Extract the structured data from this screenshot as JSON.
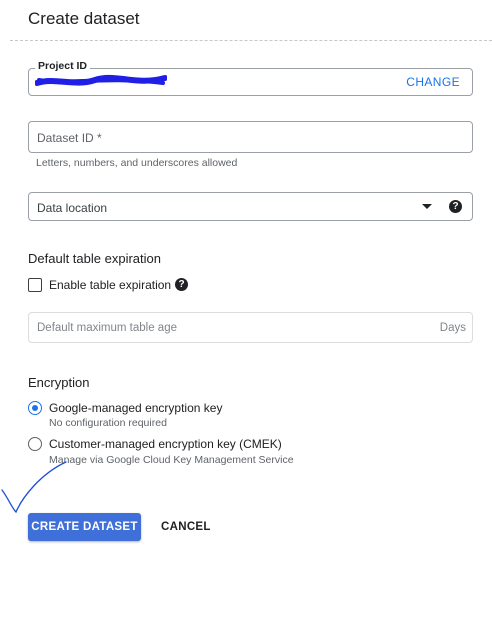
{
  "dialog": {
    "title": "Create dataset"
  },
  "project": {
    "legend": "Project ID",
    "value": "",
    "change_label": "CHANGE"
  },
  "dataset_id": {
    "placeholder": "Dataset ID *",
    "hint": "Letters, numbers, and underscores allowed"
  },
  "data_location": {
    "placeholder": "Data location"
  },
  "expiration": {
    "heading": "Default table expiration",
    "checkbox_label": "Enable table expiration",
    "checked": false,
    "age_placeholder": "Default maximum table age",
    "age_suffix": "Days"
  },
  "encryption": {
    "heading": "Encryption",
    "options": [
      {
        "label": "Google-managed encryption key",
        "sub": "No configuration required",
        "selected": true
      },
      {
        "label": "Customer-managed encryption key (CMEK)",
        "sub": "Manage via Google Cloud Key Management Service",
        "selected": false
      }
    ]
  },
  "actions": {
    "create_label": "CREATE DATASET",
    "cancel_label": "CANCEL"
  },
  "colors": {
    "accent": "#1a73e8",
    "primary_button": "#3f6fd8",
    "redaction": "#1f1fe6",
    "annotation": "#1b4fd6"
  }
}
